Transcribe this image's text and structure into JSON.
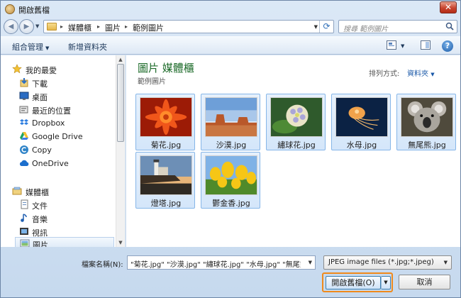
{
  "window": {
    "title": "開啟舊檔",
    "close_glyph": "✕"
  },
  "nav": {
    "back_glyph": "◀",
    "forward_glyph": "▶",
    "breadcrumb": [
      "媒體櫃",
      "圖片",
      "範例圖片"
    ],
    "separator_glyph": "▸",
    "search_placeholder": "搜尋 範例圖片"
  },
  "toolbar": {
    "organize_label": "組合管理",
    "new_folder_label": "新增資料夾",
    "help_glyph": "?"
  },
  "sidebar": {
    "favorites_label": "我的最愛",
    "favorites": [
      "下載",
      "桌面",
      "最近的位置",
      "Dropbox",
      "Google Drive",
      "Copy",
      "OneDrive"
    ],
    "libraries_label": "媒體櫃",
    "libraries": [
      "文件",
      "音樂",
      "視訊",
      "圖片"
    ],
    "selected": "圖片"
  },
  "main": {
    "library_title": "圖片 媒體櫃",
    "library_subtitle": "範例圖片",
    "arrange_label": "排列方式:",
    "arrange_value": "資料夾",
    "files": [
      {
        "name": "菊花.jpg",
        "icon": "chrysanthemum-photo"
      },
      {
        "name": "沙漠.jpg",
        "icon": "desert-photo"
      },
      {
        "name": "繡球花.jpg",
        "icon": "hydrangea-photo"
      },
      {
        "name": "水母.jpg",
        "icon": "jellyfish-photo"
      },
      {
        "name": "無尾熊.jpg",
        "icon": "koala-photo"
      },
      {
        "name": "燈塔.jpg",
        "icon": "lighthouse-photo"
      },
      {
        "name": "鬱金香.jpg",
        "icon": "tulips-photo"
      }
    ]
  },
  "footer": {
    "filename_label": "檔案名稱(N):",
    "filename_value": "\"菊花.jpg\" \"沙漠.jpg\" \"繡球花.jpg\" \"水母.jpg\" \"無尾熊",
    "filetype_value": "JPEG image files (*.jpg;*.jpeg)",
    "open_label": "開啟舊檔(O)",
    "cancel_label": "取消"
  },
  "colors": {
    "accent": "#f08a1c",
    "library_title": "#1d6b2a",
    "selection": "#d4e6fa"
  }
}
